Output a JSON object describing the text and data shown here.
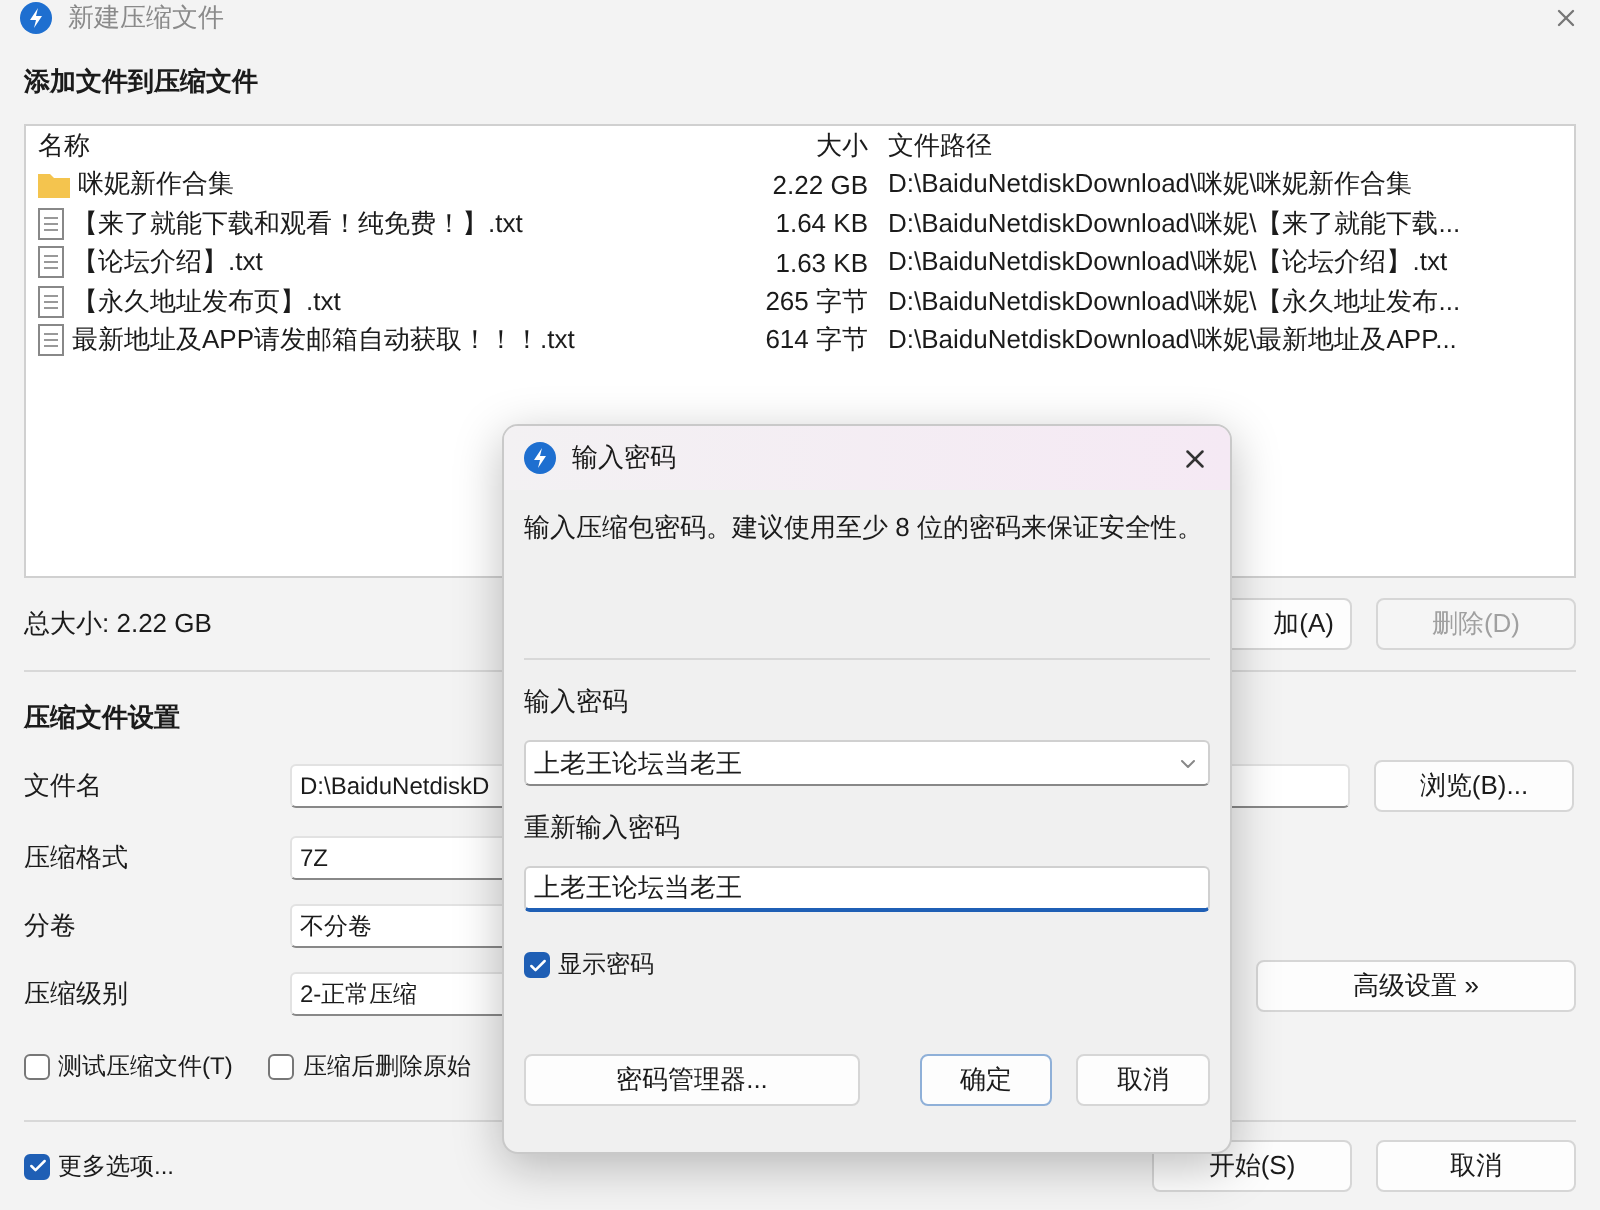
{
  "window": {
    "title": "新建压缩文件"
  },
  "header": "添加文件到压缩文件",
  "file_list": {
    "columns": [
      "名称",
      "大小",
      "文件路径"
    ],
    "rows": [
      {
        "kind": "folder",
        "name": "咪妮新作合集",
        "size": "2.22 GB",
        "path": "D:\\BaiduNetdiskDownload\\咪妮\\咪妮新作合集"
      },
      {
        "kind": "file",
        "name": "【来了就能下载和观看！纯免费！】.txt",
        "size": "1.64 KB",
        "path": "D:\\BaiduNetdiskDownload\\咪妮\\【来了就能下载..."
      },
      {
        "kind": "file",
        "name": "【论坛介绍】.txt",
        "size": "1.63 KB",
        "path": "D:\\BaiduNetdiskDownload\\咪妮\\【论坛介绍】.txt"
      },
      {
        "kind": "file",
        "name": "【永久地址发布页】.txt",
        "size": "265 字节",
        "path": "D:\\BaiduNetdiskDownload\\咪妮\\【永久地址发布..."
      },
      {
        "kind": "file",
        "name": "最新地址及APP请发邮箱自动获取！！！.txt",
        "size": "614 字节",
        "path": "D:\\BaiduNetdiskDownload\\咪妮\\最新地址及APP..."
      }
    ]
  },
  "total_size": "总大小: 2.22 GB",
  "list_buttons": [
    {
      "label": "加(A)",
      "disabled": false
    },
    {
      "label": "删除(D)",
      "disabled": true
    }
  ],
  "settings": {
    "title": "压缩文件设置",
    "fields": [
      {
        "label": "文件名",
        "kind": "text",
        "value": "D:\\BaiduNetdiskD"
      },
      {
        "label": "压缩格式",
        "kind": "combo",
        "value": "7Z"
      },
      {
        "label": "分卷",
        "kind": "combo",
        "value": "不分卷"
      },
      {
        "label": "压缩级别",
        "kind": "combo",
        "value": "2-正常压缩"
      }
    ],
    "browse_button": "浏览(B)...",
    "advanced_button": "高级设置 »",
    "options": [
      {
        "label": "测试压缩文件(T)",
        "checked": false
      },
      {
        "label": "压缩后删除原始",
        "checked": false
      }
    ]
  },
  "more_options": {
    "label": "更多选项...",
    "checked": true
  },
  "buttons": [
    "开始(S)",
    "取消"
  ],
  "password_dialog": {
    "title": "输入密码",
    "description": "输入压缩包密码。建议使用至少 8 位的密码来保证安全性。",
    "password_label": "输入密码",
    "password": "上老王论坛当老王",
    "confirm_label": "重新输入密码",
    "confirm": "上老王论坛当老王",
    "show_password": {
      "label": "显示密码",
      "checked": true
    },
    "buttons": [
      {
        "label": "密码管理器...",
        "kind": "manager"
      },
      {
        "label": "确定",
        "kind": "default"
      },
      {
        "label": "取消",
        "kind": "cancel"
      }
    ]
  }
}
